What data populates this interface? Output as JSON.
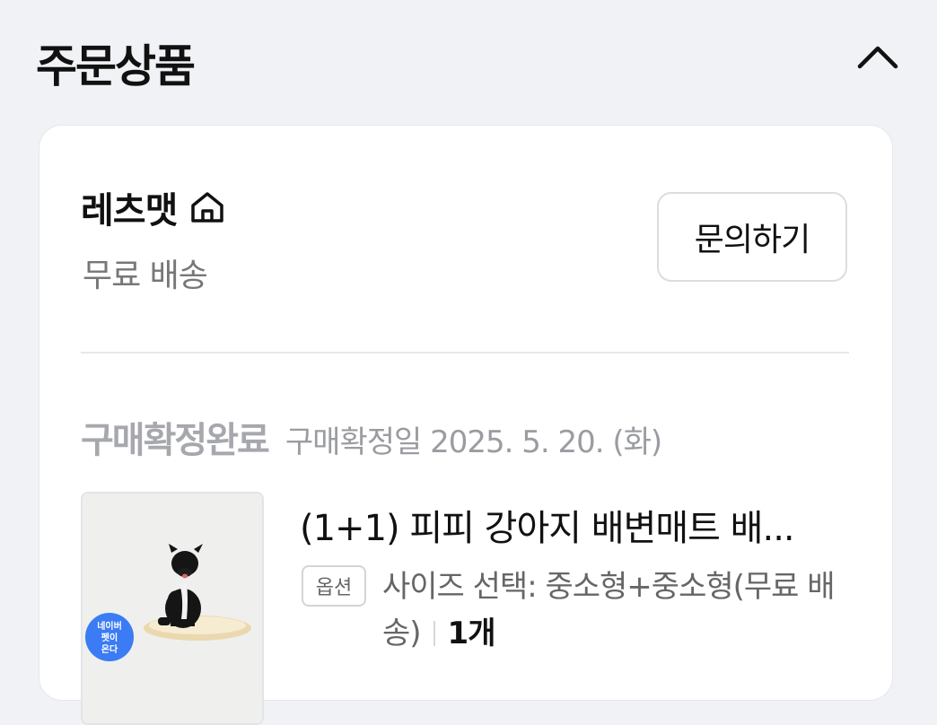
{
  "section": {
    "title": "주문상품",
    "collapse_icon": "chevron-up-icon"
  },
  "seller": {
    "name": "레츠맷",
    "store_icon": "home-icon",
    "shipping": "무료 배송",
    "inquiry_label": "문의하기"
  },
  "order": {
    "status": "구매확정완료",
    "status_date": "구매확정일 2025. 5. 20. (화)"
  },
  "product": {
    "title": "(1+1) 피피 강아지 배변매트 배...",
    "option_badge": "옵션",
    "option_text": "사이즈 선택: 중소형+중소형(무료 배송)",
    "quantity": "1개",
    "thumb_badge_lines": [
      "네이버",
      "펫이",
      "온다"
    ],
    "thumb_badge_color": "#3b7cf4"
  }
}
